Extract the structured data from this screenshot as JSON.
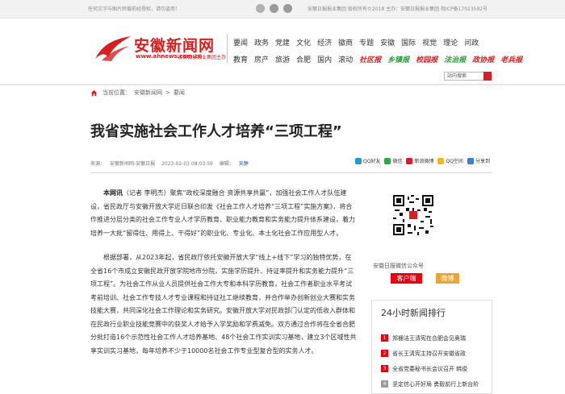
{
  "topbar": {
    "notice": "任何文字与图片转载前经授权，请勿盗用！",
    "icons": [
      "weibo-icon",
      "wechat-icon",
      "phone-icon"
    ],
    "registration": "安徽日报报业集团 版权所有©2018 主办：安徽日报报业集团 皖ICP备17023592号"
  },
  "logo": {
    "name": "安徽新闻网",
    "domain": "www.ahnews.com.cn",
    "sub": "安徽日报报业集团主办"
  },
  "nav": {
    "row1": [
      "要闻",
      "政务",
      "党建",
      "文化",
      "经济",
      "徽商",
      "专题",
      "安徽",
      "国际",
      "视觉",
      "理论",
      "问政"
    ],
    "row2": [
      "教育",
      "房产",
      "旅游",
      "合肥",
      "国内",
      "滚动"
    ],
    "row2_brands": [
      "社区报",
      "乡镇报",
      "校园报",
      "法治报",
      "政协报",
      "老兵报"
    ]
  },
  "search": {
    "placeholder": "站内搜索"
  },
  "breadcrumb": {
    "prefix": "当前位置：",
    "site": "安徽新闻网",
    "sep": ">",
    "section": "要闻"
  },
  "article": {
    "title": "我省实施社会工作人才培养“三项工程”",
    "source_label": "来源：",
    "source": "安徽新闻网-安徽日报",
    "datetime": "2023-02-03 08:03:59",
    "editor_label": "编辑：",
    "editor": "吴静",
    "lead": "本网讯",
    "para1": "（记者 李明杰）聚焦“政校深度融合 资源共享共赢”，加强社会工作人才队伍建设，省民政厅与安徽开放大学近日联合印发《社会工作人才培养“三项工程”实施方案》，将合作推进分层分类的社会工作专业人才学历教育、职业能力教育和实务能力提升体系建设，着力培养一大批“留得住、用得上、干得好”的职业化、专业化、本土化社会工作应用型人才。",
    "para2": "根据部署，从2023年起，省民政厅依托安徽开放大学“线上+线下”学习的独特优势，在全省16个市成立安徽民政开放学院地市分院，实施学历提升、持证率提升和实务能力提升“三项工程”。为社会工作从业人员提供社会工作大专和本科学历教育，社会工作者职业水平考试考前培训、社会工作专技人才专业课程和持证社工继续教育，并合作举办创新创业大赛和实务技能大赛，共同深化社会工作理论和实务研究。安徽开放大学对民政部门认定的低收入群体和在民政行业职业技能竞赛中的获奖人才给予入学奖励和学费减免。双方通过合作将在全省合肥分批打造16个示范性社会工作人才培养基地、48个社会工作实训实习基地，建立3个区域性共享实训实习基地，每年培养不少于10000名社会工作专业型复合型的实务人才。"
  },
  "share": [
    "QQ好友",
    "微信",
    "新浪微博",
    "QQ空间",
    "分享到"
  ],
  "sidebar": {
    "qr_caption": "安徽日报微信公众号",
    "client_btn": "客户端",
    "weibo_btn": "微博",
    "rank_title": "24小时新闻排行",
    "ranks": [
      {
        "num": "1",
        "text": "郑栅洁王清宪在合肥会见奥瑞"
      },
      {
        "num": "2",
        "text": "省长王清宪主持召开安徽省政"
      },
      {
        "num": "3",
        "text": "全省党委秘书长会议召开 韩俊"
      },
      {
        "num": "4",
        "text": "坚定信心开好局 勇毅前行上新台阶"
      }
    ]
  },
  "colors": {
    "brand_red": "#d61f1f",
    "accent_red": "#e60012",
    "weibo_orange": "#e8a63a"
  }
}
